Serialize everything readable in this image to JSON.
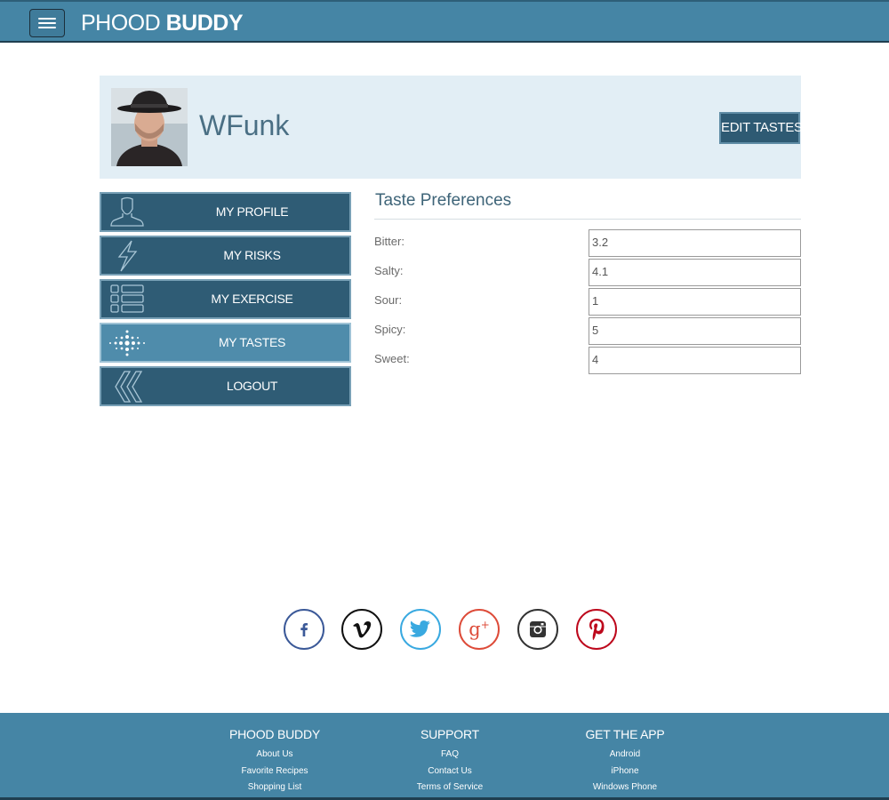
{
  "header": {
    "brand_light": "PHOOD ",
    "brand_bold": "BUDDY",
    "menu_icon": "hamburger-menu-icon",
    "color": "#4585a5"
  },
  "profile": {
    "username": "WFunk",
    "edit_label": "EDIT TASTES",
    "panel_color": "#e2eef5"
  },
  "sidebar": {
    "items": [
      {
        "label": "MY PROFILE",
        "icon": "person-icon",
        "active": false
      },
      {
        "label": "MY RISKS",
        "icon": "lightning-icon",
        "active": false
      },
      {
        "label": "MY EXERCISE",
        "icon": "list-icon",
        "active": false
      },
      {
        "label": "MY TASTES",
        "icon": "dots-icon",
        "active": true
      },
      {
        "label": "LOGOUT",
        "icon": "chevrons-left-icon",
        "active": false
      }
    ]
  },
  "tastes": {
    "title": "Taste Preferences",
    "rows": [
      {
        "label": "Bitter:",
        "value": "3.2"
      },
      {
        "label": "Salty:",
        "value": "4.1"
      },
      {
        "label": "Sour:",
        "value": "1"
      },
      {
        "label": "Spicy:",
        "value": "5"
      },
      {
        "label": "Sweet:",
        "value": "4"
      }
    ]
  },
  "social": [
    {
      "name": "facebook-icon",
      "glyph": "f",
      "color": "#3b5998"
    },
    {
      "name": "vimeo-icon",
      "glyph": "v",
      "color": "#111111"
    },
    {
      "name": "twitter-icon",
      "glyph": "t",
      "color": "#39a9e0"
    },
    {
      "name": "google-plus-icon",
      "glyph": "g+",
      "color": "#dd4b39"
    },
    {
      "name": "instagram-icon",
      "glyph": "cam",
      "color": "#333333"
    },
    {
      "name": "pinterest-icon",
      "glyph": "p",
      "color": "#bd081c"
    }
  ],
  "footer": {
    "columns": [
      {
        "title": "PHOOD BUDDY",
        "links": [
          "About Us",
          "Favorite Recipes",
          "Shopping List"
        ]
      },
      {
        "title": "SUPPORT",
        "links": [
          "FAQ",
          "Contact Us",
          "Terms of Service"
        ]
      },
      {
        "title": "GET THE APP",
        "links": [
          "Android",
          "iPhone",
          "Windows Phone"
        ]
      }
    ]
  }
}
